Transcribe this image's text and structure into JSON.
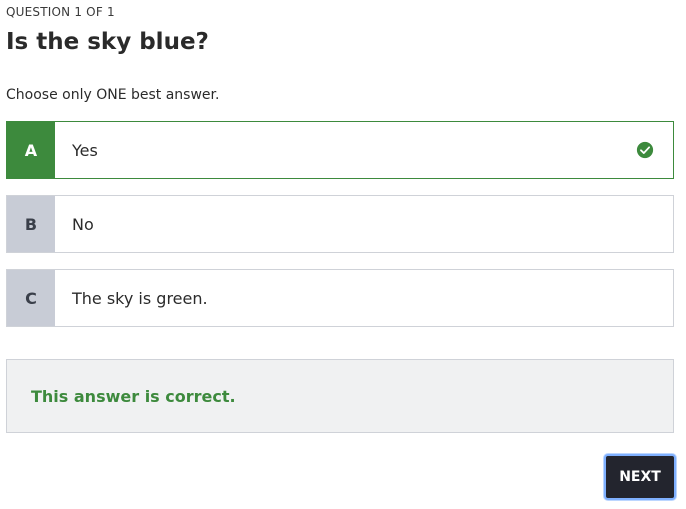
{
  "question": {
    "counter": "QUESTION 1 OF 1",
    "title": "Is the sky blue?",
    "instruction": "Choose only ONE best answer."
  },
  "options": [
    {
      "letter": "A",
      "text": "Yes",
      "state": "correct-selected"
    },
    {
      "letter": "B",
      "text": "No",
      "state": "unselected"
    },
    {
      "letter": "C",
      "text": "The sky is green.",
      "state": "unselected"
    }
  ],
  "feedback": {
    "message": "This answer is correct."
  },
  "actions": {
    "next_label": "NEXT"
  },
  "colors": {
    "correct": "#3d8a3d",
    "option_letter_bg": "#c8ccd6",
    "feedback_bg": "#f0f1f2",
    "next_button_bg": "#23252e",
    "focus_ring": "#7fb0ff"
  },
  "icons": {
    "correct_indicator": "check-circle-icon"
  }
}
